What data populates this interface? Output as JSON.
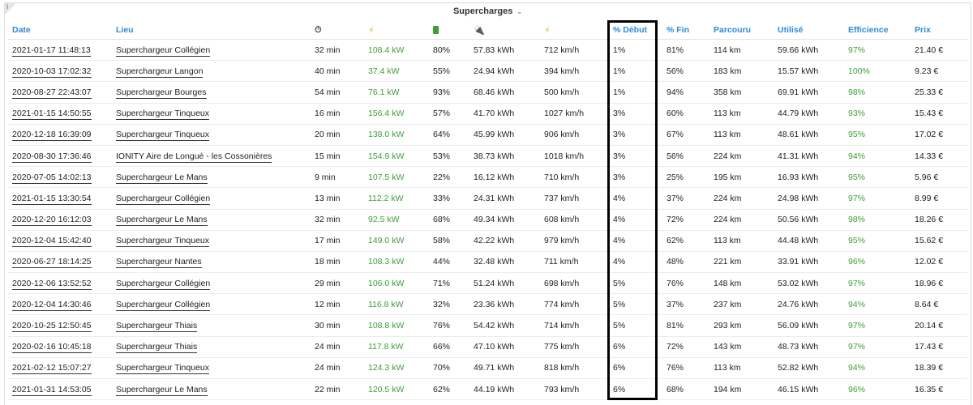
{
  "panel": {
    "title": "Supercharges",
    "info_icon": "info-icon",
    "chevron_icon": "chevron-down-icon"
  },
  "columns": {
    "date": "Date",
    "lieu": "Lieu",
    "duration_icon": "timer-icon",
    "power_icon": "bolt-icon",
    "battery_icon": "battery-icon",
    "energy_icon": "plug-icon",
    "rate_icon": "bolt-icon",
    "debut": "% Début",
    "fin": "% Fin",
    "parcouru": "Parcouru",
    "utilise": "Utilisé",
    "efficience": "Efficience",
    "prix": "Prix"
  },
  "colors": {
    "header": "#2e8bd8",
    "good": "#3f9e38",
    "highlight": "#000000"
  },
  "rows": [
    {
      "date": "2021-01-17 11:48:13",
      "lieu": "Superchargeur Collégien",
      "duree": "32 min",
      "puissance": "108.4 kW",
      "batterie": "80%",
      "energie": "57.83 kWh",
      "vitesse": "712 km/h",
      "debut": "1%",
      "fin": "81%",
      "parcouru": "114 km",
      "utilise": "59.66 kWh",
      "efficience": "97%",
      "prix": "21.40 €"
    },
    {
      "date": "2020-10-03 17:02:32",
      "lieu": "Superchargeur Langon",
      "duree": "40 min",
      "puissance": "37.4 kW",
      "batterie": "55%",
      "energie": "24.94 kWh",
      "vitesse": "394 km/h",
      "debut": "1%",
      "fin": "56%",
      "parcouru": "183 km",
      "utilise": "15.57 kWh",
      "efficience": "100%",
      "prix": "9.23 €"
    },
    {
      "date": "2020-08-27 22:43:07",
      "lieu": "Superchargeur Bourges",
      "duree": "54 min",
      "puissance": "76.1 kW",
      "batterie": "93%",
      "energie": "68.46 kWh",
      "vitesse": "500 km/h",
      "debut": "1%",
      "fin": "94%",
      "parcouru": "358 km",
      "utilise": "69.91 kWh",
      "efficience": "98%",
      "prix": "25.33 €"
    },
    {
      "date": "2021-01-15 14:50:55",
      "lieu": "Superchargeur Tinqueux",
      "duree": "16 min",
      "puissance": "156.4 kW",
      "batterie": "57%",
      "energie": "41.70 kWh",
      "vitesse": "1027 km/h",
      "debut": "3%",
      "fin": "60%",
      "parcouru": "113 km",
      "utilise": "44.79 kWh",
      "efficience": "93%",
      "prix": "15.43 €"
    },
    {
      "date": "2020-12-18 16:39:09",
      "lieu": "Superchargeur Tinqueux",
      "duree": "20 min",
      "puissance": "138.0 kW",
      "batterie": "64%",
      "energie": "45.99 kWh",
      "vitesse": "906 km/h",
      "debut": "3%",
      "fin": "67%",
      "parcouru": "113 km",
      "utilise": "48.61 kWh",
      "efficience": "95%",
      "prix": "17.02 €"
    },
    {
      "date": "2020-08-30 17:36:46",
      "lieu": "IONITY Aire de Longué - les Cossonières",
      "duree": "15 min",
      "puissance": "154.9 kW",
      "batterie": "53%",
      "energie": "38.73 kWh",
      "vitesse": "1018 km/h",
      "debut": "3%",
      "fin": "56%",
      "parcouru": "224 km",
      "utilise": "41.31 kWh",
      "efficience": "94%",
      "prix": "14.33 €"
    },
    {
      "date": "2020-07-05 14:02:13",
      "lieu": "Superchargeur Le Mans",
      "duree": "9 min",
      "puissance": "107.5 kW",
      "batterie": "22%",
      "energie": "16.12 kWh",
      "vitesse": "710 km/h",
      "debut": "3%",
      "fin": "25%",
      "parcouru": "195 km",
      "utilise": "16.93 kWh",
      "efficience": "95%",
      "prix": "5.96 €"
    },
    {
      "date": "2021-01-15 13:30:54",
      "lieu": "Superchargeur Collégien",
      "duree": "13 min",
      "puissance": "112.2 kW",
      "batterie": "33%",
      "energie": "24.31 kWh",
      "vitesse": "737 km/h",
      "debut": "4%",
      "fin": "37%",
      "parcouru": "224 km",
      "utilise": "24.98 kWh",
      "efficience": "97%",
      "prix": "8.99 €"
    },
    {
      "date": "2020-12-20 16:12:03",
      "lieu": "Superchargeur Le Mans",
      "duree": "32 min",
      "puissance": "92.5 kW",
      "batterie": "68%",
      "energie": "49.34 kWh",
      "vitesse": "608 km/h",
      "debut": "4%",
      "fin": "72%",
      "parcouru": "224 km",
      "utilise": "50.56 kWh",
      "efficience": "98%",
      "prix": "18.26 €"
    },
    {
      "date": "2020-12-04 15:42:40",
      "lieu": "Superchargeur Tinqueux",
      "duree": "17 min",
      "puissance": "149.0 kW",
      "batterie": "58%",
      "energie": "42.22 kWh",
      "vitesse": "979 km/h",
      "debut": "4%",
      "fin": "62%",
      "parcouru": "113 km",
      "utilise": "44.48 kWh",
      "efficience": "95%",
      "prix": "15.62 €"
    },
    {
      "date": "2020-06-27 18:14:25",
      "lieu": "Superchargeur Nantes",
      "duree": "18 min",
      "puissance": "108.3 kW",
      "batterie": "44%",
      "energie": "32.48 kWh",
      "vitesse": "711 km/h",
      "debut": "4%",
      "fin": "48%",
      "parcouru": "221 km",
      "utilise": "33.91 kWh",
      "efficience": "96%",
      "prix": "12.02 €"
    },
    {
      "date": "2020-12-06 13:52:52",
      "lieu": "Superchargeur Collégien",
      "duree": "29 min",
      "puissance": "106.0 kW",
      "batterie": "71%",
      "energie": "51.24 kWh",
      "vitesse": "698 km/h",
      "debut": "5%",
      "fin": "76%",
      "parcouru": "148 km",
      "utilise": "53.02 kWh",
      "efficience": "97%",
      "prix": "18.96 €"
    },
    {
      "date": "2020-12-04 14:30:46",
      "lieu": "Superchargeur Collégien",
      "duree": "12 min",
      "puissance": "116.8 kW",
      "batterie": "32%",
      "energie": "23.36 kWh",
      "vitesse": "774 km/h",
      "debut": "5%",
      "fin": "37%",
      "parcouru": "237 km",
      "utilise": "24.76 kWh",
      "efficience": "94%",
      "prix": "8.64 €"
    },
    {
      "date": "2020-10-25 12:50:45",
      "lieu": "Superchargeur Thiais",
      "duree": "30 min",
      "puissance": "108.8 kW",
      "batterie": "76%",
      "energie": "54.42 kWh",
      "vitesse": "714 km/h",
      "debut": "5%",
      "fin": "81%",
      "parcouru": "293 km",
      "utilise": "56.09 kWh",
      "efficience": "97%",
      "prix": "20.14 €"
    },
    {
      "date": "2020-02-16 10:45:18",
      "lieu": "Superchargeur Thiais",
      "duree": "24 min",
      "puissance": "117.8 kW",
      "batterie": "66%",
      "energie": "47.10 kWh",
      "vitesse": "775 km/h",
      "debut": "6%",
      "fin": "72%",
      "parcouru": "143 km",
      "utilise": "48.73 kWh",
      "efficience": "97%",
      "prix": "17.43 €"
    },
    {
      "date": "2021-02-12 15:07:27",
      "lieu": "Superchargeur Tinqueux",
      "duree": "24 min",
      "puissance": "124.3 kW",
      "batterie": "70%",
      "energie": "49.71 kWh",
      "vitesse": "818 km/h",
      "debut": "6%",
      "fin": "76%",
      "parcouru": "113 km",
      "utilise": "52.82 kWh",
      "efficience": "94%",
      "prix": "18.39 €"
    },
    {
      "date": "2021-01-31 14:53:05",
      "lieu": "Superchargeur Le Mans",
      "duree": "22 min",
      "puissance": "120.5 kW",
      "batterie": "62%",
      "energie": "44.19 kWh",
      "vitesse": "793 km/h",
      "debut": "6%",
      "fin": "68%",
      "parcouru": "194 km",
      "utilise": "46.15 kWh",
      "efficience": "96%",
      "prix": "16.35 €"
    }
  ]
}
